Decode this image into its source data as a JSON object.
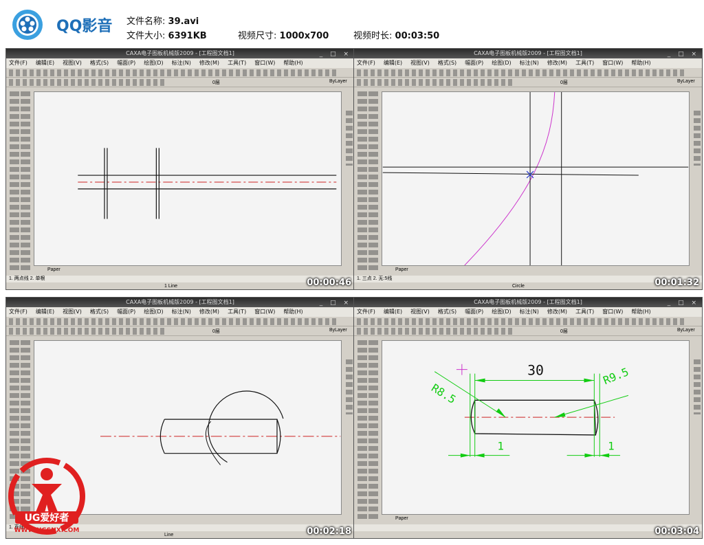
{
  "header": {
    "app_name": "QQ影音",
    "file_name_label": "文件名称:",
    "file_name": "39.avi",
    "file_size_label": "文件大小:",
    "file_size": "6391KB",
    "video_size_label": "视频尺寸:",
    "video_size": "1000x700",
    "duration_label": "视频时长:",
    "duration": "00:03:50"
  },
  "app": {
    "title": "CAXA电子图板机械版2009 - [工程图文档1]",
    "menu": [
      "文件(F)",
      "编辑(E)",
      "视图(V)",
      "格式(S)",
      "幅面(P)",
      "绘图(D)",
      "标注(N)",
      "修改(M)",
      "工具(T)",
      "窗口(W)",
      "帮助(H)"
    ],
    "layer_name": "0层",
    "linetype": "ByLayer",
    "tab_label": "Paper"
  },
  "panels": [
    {
      "timestamp": "00:00:46",
      "cmd": "1. 两点线  2. 单根",
      "status": "1 Line"
    },
    {
      "timestamp": "00:01:32",
      "cmd": "1. 三点  2. 无:5线",
      "status": "Circle"
    },
    {
      "timestamp": "00:02:18",
      "cmd": "1. 直线",
      "status": "Line"
    },
    {
      "timestamp": "00:03:04",
      "cmd": "",
      "status": ""
    }
  ],
  "drawing4": {
    "dim_top": "30",
    "dim_left_radius": "R8.5",
    "dim_right_radius": "R9.5",
    "dim_left_small": "1",
    "dim_right_small": "1"
  },
  "watermark": {
    "text": "UG爱好者",
    "url": "WWW.UGSNX.COM"
  },
  "colors": {
    "centerline": "#cc2222",
    "construction": "#cc33cc",
    "dimension": "#11cc11",
    "title_blue": "#1e6fb8"
  }
}
